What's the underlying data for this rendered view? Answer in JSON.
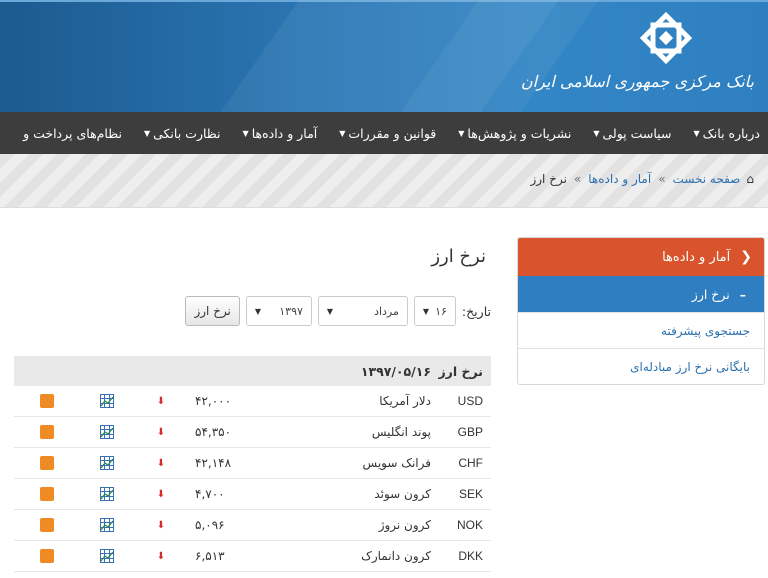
{
  "header": {
    "bank_name": "بانک مرکزی جمهوری اسلامی ایران",
    "logo_icon": "cbi-logo-icon",
    "colors": {
      "header_blue": "#2d79b8",
      "nav_bg": "#3d3d3d",
      "sidebar_head": "#d9542c",
      "sidebar_active": "#2f7ec1"
    }
  },
  "nav": {
    "items": [
      {
        "label": "درباره بانک"
      },
      {
        "label": "سیاست پولی"
      },
      {
        "label": "نشریات و پژوهش‌ها"
      },
      {
        "label": "قوانین و مقررات"
      },
      {
        "label": "آمار و داده‌ها"
      },
      {
        "label": "نظارت بانکی"
      },
      {
        "label": "نظام‌های پرداخت و"
      }
    ]
  },
  "breadcrumb": {
    "home": "صفحه نخست",
    "sep": "»",
    "section": "آمار و داده‌ها",
    "current": "نرخ ارز"
  },
  "sidebar": {
    "header": "آمار و داده‌ها",
    "active": "نرخ ارز",
    "items": [
      {
        "label": "جستجوی پیشرفته"
      },
      {
        "label": "بایگانی نرخ ارز مبادله‌ای"
      }
    ]
  },
  "main": {
    "title": "نرخ ارز",
    "date_label": "تاریخ:",
    "day": "۱۶",
    "month": "مرداد",
    "year": "۱۳۹۷",
    "button": "نرخ ارز"
  },
  "table": {
    "header_code": "نرخ ارز",
    "header_date": "۱۳۹۷/۰۵/۱۶",
    "rows": [
      {
        "code": "USD",
        "name": "دلار آمریکا",
        "value": "۴۲,۰۰۰"
      },
      {
        "code": "GBP",
        "name": "پوند انگلیس",
        "value": "۵۴,۳۵۰"
      },
      {
        "code": "CHF",
        "name": "فرانک سویس",
        "value": "۴۲,۱۴۸"
      },
      {
        "code": "SEK",
        "name": "کرون سوئد",
        "value": "۴,۷۰۰"
      },
      {
        "code": "NOK",
        "name": "کرون نروژ",
        "value": "۵,۰۹۶"
      },
      {
        "code": "DKK",
        "name": "کرون دانمارک",
        "value": "۶,۵۱۳"
      }
    ]
  }
}
